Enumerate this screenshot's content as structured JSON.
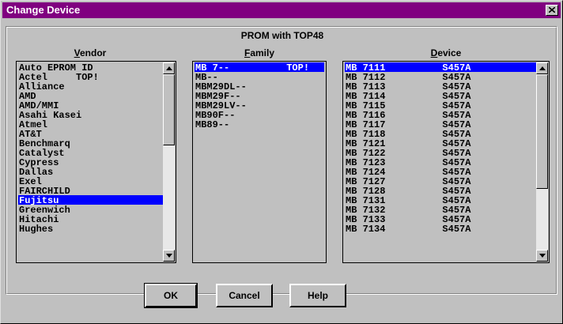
{
  "window": {
    "title": "Change Device"
  },
  "group": {
    "title": "PROM with TOP48"
  },
  "vendor": {
    "header": "Vendor",
    "accesskey": "V",
    "items": [
      "Auto EPROM ID",
      "Actel     TOP!",
      "Alliance",
      "AMD",
      "AMD/MMI",
      "Asahi Kasei",
      "Atmel",
      "AT&T",
      "Benchmarq",
      "Catalyst",
      "Cypress",
      "Dallas",
      "Exel",
      "FAIRCHILD",
      "Fujitsu",
      "Greenwich",
      "Hitachi",
      "Hughes"
    ],
    "selected_index": 14
  },
  "family": {
    "header": "Family",
    "accesskey": "F",
    "items": [
      "MB 7--          TOP!",
      "MB--",
      "MBM29DL--",
      "MBM29F--",
      "MBM29LV--",
      "MB90F--",
      "MB89--"
    ],
    "selected_index": 0
  },
  "device": {
    "header": "Device",
    "accesskey": "D",
    "items": [
      "MB 7111          S457A",
      "MB 7112          S457A",
      "MB 7113          S457A",
      "MB 7114          S457A",
      "MB 7115          S457A",
      "MB 7116          S457A",
      "MB 7117          S457A",
      "MB 7118          S457A",
      "MB 7121          S457A",
      "MB 7122          S457A",
      "MB 7123          S457A",
      "MB 7124          S457A",
      "MB 7127          S457A",
      "MB 7128          S457A",
      "MB 7131          S457A",
      "MB 7132          S457A",
      "MB 7133          S457A",
      "MB 7134          S457A"
    ],
    "selected_index": 0
  },
  "buttons": {
    "ok": "OK",
    "cancel": "Cancel",
    "help": "Help"
  },
  "colors": {
    "title_bar": "#800080",
    "selection": "#0000ff",
    "face": "#c0c0c0"
  },
  "icons": {
    "close": "close-icon",
    "scroll_up": "arrow-up-icon",
    "scroll_down": "arrow-down-icon"
  }
}
